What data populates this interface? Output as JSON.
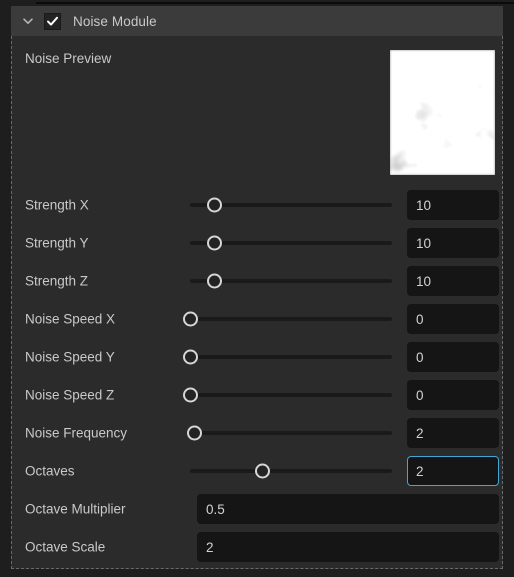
{
  "header": {
    "title": "Noise Module",
    "chevron_icon": "chevron-down-icon",
    "checkbox_icon": "checkmark-icon",
    "checked": true,
    "background": "#3b3b3b"
  },
  "preview": {
    "label": "Noise Preview",
    "type": "grayscale-noise-texture"
  },
  "theme": {
    "panel_background": "#2b2b2b",
    "page_background": "#1e1e1e",
    "label_color": "#c9c9c9",
    "value_color": "#d2d2d2",
    "input_background": "#151515",
    "track_color": "#1a1a1a",
    "handle_border": "#d6d6d6",
    "focus_accent": "#3fa9d4",
    "dashed_border": "#6b6b6b"
  },
  "rows": [
    {
      "label": "Strength X",
      "value": "10",
      "slider": true,
      "handle_pct": 12,
      "focused": false
    },
    {
      "label": "Strength Y",
      "value": "10",
      "slider": true,
      "handle_pct": 12,
      "focused": false
    },
    {
      "label": "Strength Z",
      "value": "10",
      "slider": true,
      "handle_pct": 12,
      "focused": false
    },
    {
      "label": "Noise Speed X",
      "value": "0",
      "slider": true,
      "handle_pct": 0,
      "focused": false
    },
    {
      "label": "Noise Speed Y",
      "value": "0",
      "slider": true,
      "handle_pct": 0,
      "focused": false
    },
    {
      "label": "Noise Speed Z",
      "value": "0",
      "slider": true,
      "handle_pct": 0,
      "focused": false
    },
    {
      "label": "Noise Frequency",
      "value": "2",
      "slider": true,
      "handle_pct": 2,
      "focused": false
    },
    {
      "label": "Octaves",
      "value": "2",
      "slider": true,
      "handle_pct": 36,
      "focused": true
    },
    {
      "label": "Octave Multiplier",
      "value": "0.5",
      "slider": false,
      "handle_pct": 0,
      "focused": false
    },
    {
      "label": "Octave Scale",
      "value": "2",
      "slider": false,
      "handle_pct": 0,
      "focused": false
    }
  ]
}
